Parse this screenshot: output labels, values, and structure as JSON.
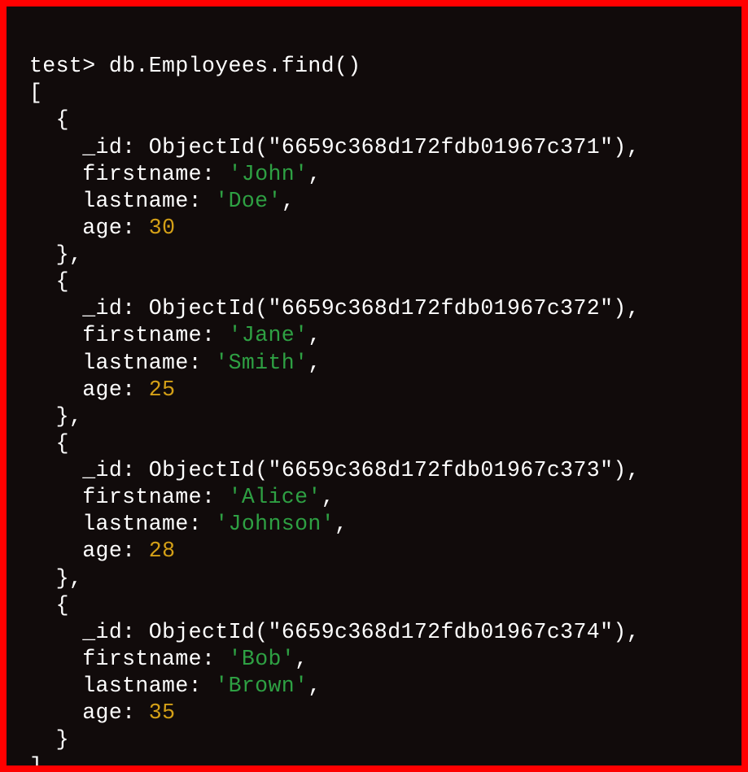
{
  "prompt": "test>",
  "command": "db.Employees.find()",
  "objectid_fn": "ObjectId",
  "records": [
    {
      "_id": "6659c368d172fdb01967c371",
      "firstname": "John",
      "lastname": "Doe",
      "age": 30
    },
    {
      "_id": "6659c368d172fdb01967c372",
      "firstname": "Jane",
      "lastname": "Smith",
      "age": 25
    },
    {
      "_id": "6659c368d172fdb01967c373",
      "firstname": "Alice",
      "lastname": "Johnson",
      "age": 28
    },
    {
      "_id": "6659c368d172fdb01967c374",
      "firstname": "Bob",
      "lastname": "Brown",
      "age": 35
    }
  ],
  "keys": {
    "id": "_id",
    "firstname": "firstname",
    "lastname": "lastname",
    "age": "age"
  },
  "brackets": {
    "open": "[",
    "close": "]"
  },
  "braces": {
    "open": "{",
    "close": "}"
  },
  "colon": ":",
  "comma": ",",
  "paren": {
    "open": "(",
    "close": ")"
  },
  "quote": "'",
  "dquote": "\""
}
